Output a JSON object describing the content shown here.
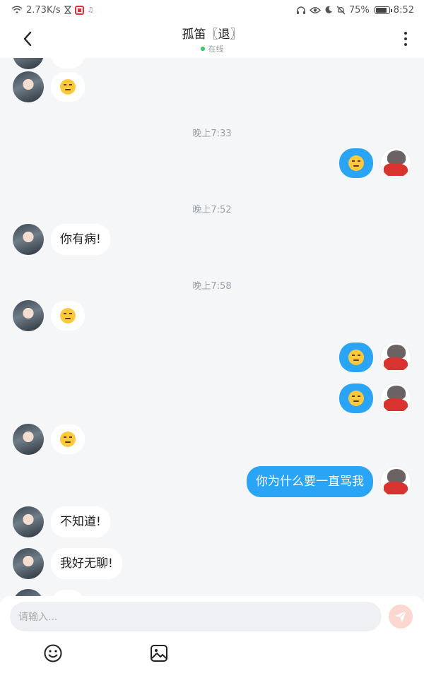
{
  "status_bar": {
    "net_speed": "2.73K/s",
    "battery": "75%",
    "time": "8:52"
  },
  "header": {
    "title": "孤笛〖退〗",
    "status": "在线"
  },
  "messages": [
    {
      "side": "left",
      "type": "emoji",
      "emoji": "unamused-face-emoji"
    },
    {
      "timestamp": "晚上7:33"
    },
    {
      "side": "right",
      "type": "emoji",
      "emoji": "unamused-face-emoji"
    },
    {
      "timestamp": "晚上7:52"
    },
    {
      "side": "left",
      "type": "text",
      "text": "你有病!"
    },
    {
      "timestamp": "晚上7:58"
    },
    {
      "side": "left",
      "type": "emoji",
      "emoji": "smirking-face-emoji"
    },
    {
      "side": "right",
      "type": "emoji",
      "emoji": "unamused-face-emoji"
    },
    {
      "side": "right",
      "type": "emoji",
      "emoji": "face-with-steam-emoji"
    },
    {
      "side": "left",
      "type": "emoji",
      "emoji": "unamused-face-emoji"
    },
    {
      "side": "right",
      "type": "text",
      "text": "你为什么要一直骂我"
    },
    {
      "side": "left",
      "type": "text",
      "text": "不知道!"
    },
    {
      "side": "left",
      "type": "text",
      "text": "我好无聊!"
    }
  ],
  "input": {
    "placeholder": "请输入..."
  },
  "colors": {
    "accent": "#2aa4f4",
    "online": "#2ccf5e",
    "send_button": "#fbd7cf"
  },
  "icons": {
    "emoji_button": "smiley-icon",
    "image_button": "image-icon",
    "send": "send-icon"
  }
}
